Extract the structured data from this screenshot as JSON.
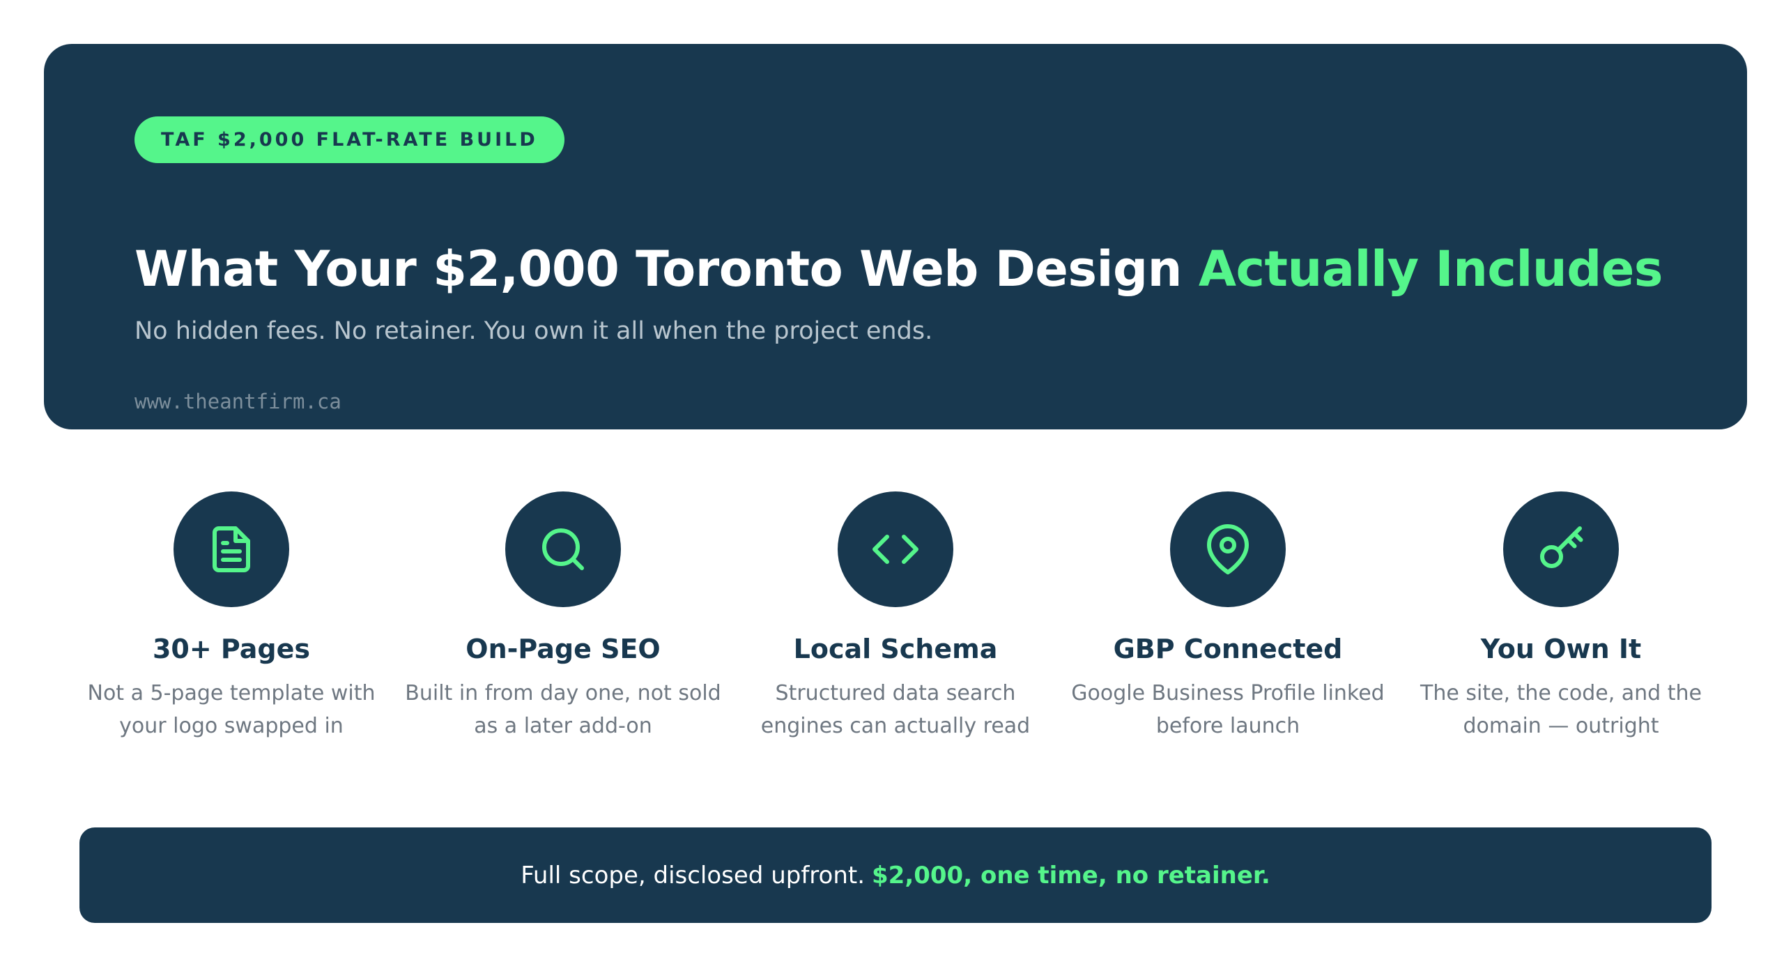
{
  "colors": {
    "navy": "#18384f",
    "accent": "#55f58b",
    "muted": "#6e7781"
  },
  "hero": {
    "badge": "TAF $2,000 FLAT-RATE BUILD",
    "title_main": "What Your $2,000 Toronto Web Design ",
    "title_accent": "Actually Includes",
    "subtitle": "No hidden fees. No retainer. You own it all when the project ends.",
    "url": "www.theantfirm.ca"
  },
  "features": [
    {
      "icon": "document-icon",
      "title": "30+ Pages",
      "desc_line1": "Not a 5-page template with",
      "desc_line2": "your logo swapped in"
    },
    {
      "icon": "search-icon",
      "title": "On-Page SEO",
      "desc_line1": "Built in from day one, not sold",
      "desc_line2": "as a later add-on"
    },
    {
      "icon": "code-icon",
      "title": "Local Schema",
      "desc_line1": "Structured data search",
      "desc_line2": "engines can actually read"
    },
    {
      "icon": "map-pin-icon",
      "title": "GBP Connected",
      "desc_line1": "Google Business Profile linked",
      "desc_line2": "before launch"
    },
    {
      "icon": "key-icon",
      "title": "You Own It",
      "desc_line1": "The site, the code, and the",
      "desc_line2": "domain — outright"
    }
  ],
  "footer": {
    "text": "Full scope, disclosed upfront.",
    "accent": "$2,000, one time, no retainer."
  }
}
